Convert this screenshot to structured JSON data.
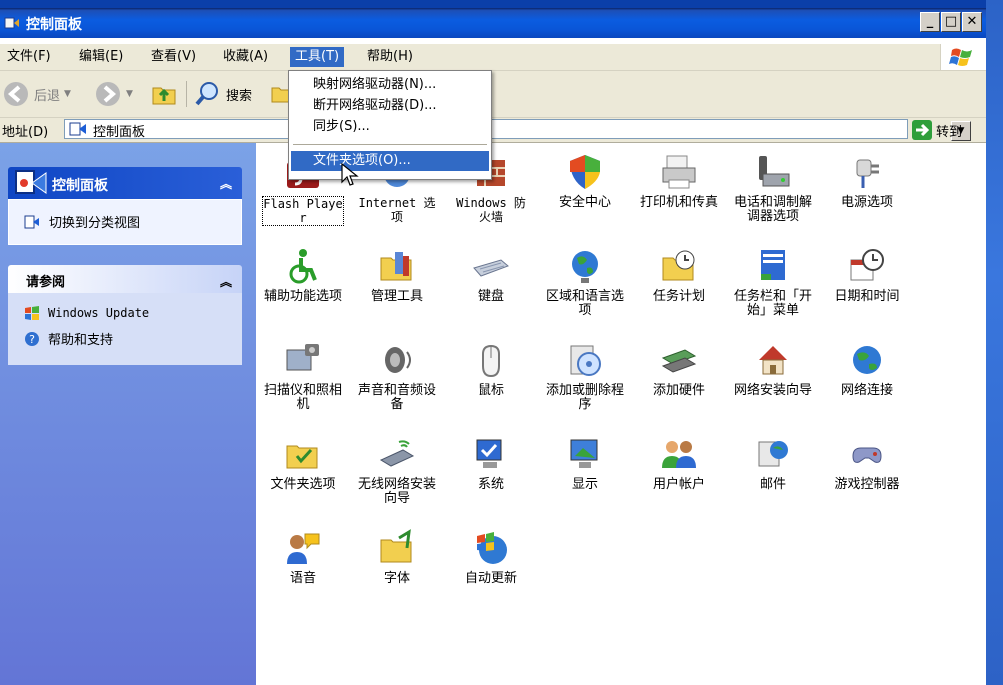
{
  "window": {
    "title": "控制面板"
  },
  "menubar": {
    "items": [
      "文件(F)",
      "编辑(E)",
      "查看(V)",
      "收藏(A)",
      "工具(T)",
      "帮助(H)"
    ]
  },
  "toolbar": {
    "back_label": "后退",
    "search_label": "搜索"
  },
  "address": {
    "label": "地址(D)",
    "value": "控制面板",
    "go_label": "转到"
  },
  "tools_menu": {
    "items": [
      "映射网络驱动器(N)...",
      "断开网络驱动器(D)...",
      "同步(S)...",
      "文件夹选项(O)..."
    ]
  },
  "left_pane": {
    "panel_title": "控制面板",
    "switch_view": "切换到分类视图",
    "see_also_title": "请参阅",
    "see_also": [
      "Windows Update",
      "帮助和支持"
    ]
  },
  "control_panel_items": [
    "Flash Player",
    "Internet 选项",
    "Windows 防火墙",
    "安全中心",
    "打印机和传真",
    "电话和调制解调器选项",
    "电源选项",
    "辅助功能选项",
    "管理工具",
    "键盘",
    "区域和语言选项",
    "任务计划",
    "任务栏和「开始」菜单",
    "日期和时间",
    "扫描仪和照相机",
    "声音和音频设备",
    "鼠标",
    "添加或删除程序",
    "添加硬件",
    "网络安装向导",
    "网络连接",
    "文件夹选项",
    "无线网络安装向导",
    "系统",
    "显示",
    "用户帐户",
    "邮件",
    "游戏控制器",
    "语音",
    "字体",
    "自动更新"
  ],
  "colors": {
    "selection": "#316ac5",
    "titlebar": "#0a56d8",
    "taskpane": "#6f8fe0"
  }
}
